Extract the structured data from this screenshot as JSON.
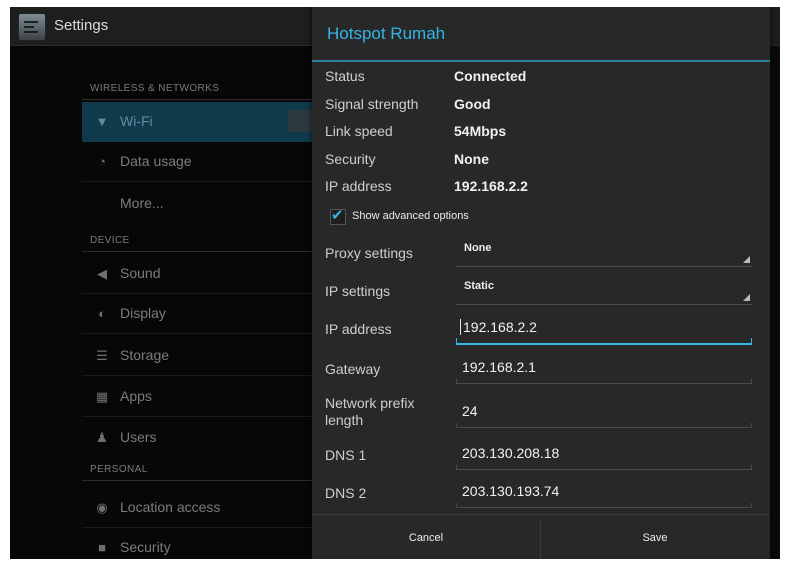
{
  "app": {
    "title": "Settings",
    "icon": "settings-app-icon"
  },
  "sidebar": {
    "sections": [
      {
        "header": "WIRELESS & NETWORKS"
      },
      {
        "header": "DEVICE"
      },
      {
        "header": "PERSONAL"
      }
    ],
    "items": [
      {
        "label": "Wi-Fi",
        "icon": "wifi-icon"
      },
      {
        "label": "Data usage",
        "icon": "data-usage-icon"
      },
      {
        "label": "More..."
      },
      {
        "label": "Sound",
        "icon": "sound-icon"
      },
      {
        "label": "Display",
        "icon": "display-icon"
      },
      {
        "label": "Storage",
        "icon": "storage-icon"
      },
      {
        "label": "Apps",
        "icon": "apps-icon"
      },
      {
        "label": "Users",
        "icon": "users-icon"
      },
      {
        "label": "Location access",
        "icon": "location-icon"
      },
      {
        "label": "Security",
        "icon": "lock-icon"
      }
    ]
  },
  "dialog": {
    "title": "Hotspot Rumah",
    "info": {
      "status_label": "Status",
      "status_value": "Connected",
      "signal_label": "Signal strength",
      "signal_value": "Good",
      "link_label": "Link speed",
      "link_value": "54Mbps",
      "security_label": "Security",
      "security_value": "None",
      "ip_label": "IP address",
      "ip_value": "192.168.2.2"
    },
    "advanced": {
      "label": "Show advanced options",
      "checked": true
    },
    "proxy": {
      "label": "Proxy settings",
      "value": "None"
    },
    "ip_settings": {
      "label": "IP settings",
      "value": "Static"
    },
    "fields": {
      "ip_address": {
        "label": "IP address",
        "value": "192.168.2.2"
      },
      "gateway": {
        "label": "Gateway",
        "value": "192.168.2.1"
      },
      "prefix": {
        "label": "Network prefix length",
        "value": "24"
      },
      "dns1": {
        "label": "DNS 1",
        "value": "203.130.208.18"
      },
      "dns2": {
        "label": "DNS 2",
        "value": "203.130.193.74"
      }
    },
    "buttons": {
      "cancel": "Cancel",
      "save": "Save"
    }
  },
  "colors": {
    "accent": "#33b5e5",
    "dialog_bg": "#282828",
    "background": "#0c0c0c"
  }
}
